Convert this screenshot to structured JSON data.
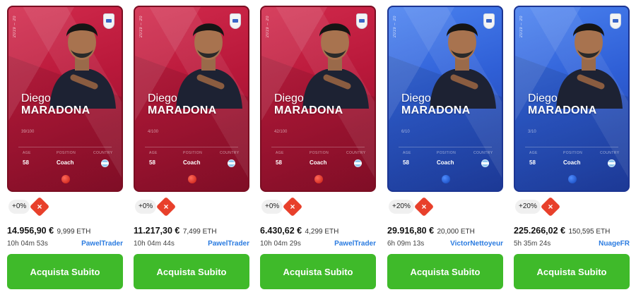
{
  "cards": [
    {
      "theme": "red",
      "season": "2019 – 20",
      "first_name": "Diego",
      "last_name": "MARADONA",
      "serial": "39/100",
      "labels": {
        "age": "AGE",
        "position": "POSITION",
        "country": "COUNTRY"
      },
      "age": "58",
      "position": "Coach",
      "change": "+0%",
      "remove_icon": "close-icon",
      "price_eur": "14.956,90 €",
      "price_eth": "9,999 ETH",
      "time_left": "10h 04m 53s",
      "seller": "PawelTrader",
      "buy_label": "Acquista Subito"
    },
    {
      "theme": "red",
      "season": "2019 – 20",
      "first_name": "Diego",
      "last_name": "MARADONA",
      "serial": "4/100",
      "labels": {
        "age": "AGE",
        "position": "POSITION",
        "country": "COUNTRY"
      },
      "age": "58",
      "position": "Coach",
      "change": "+0%",
      "remove_icon": "close-icon",
      "price_eur": "11.217,30 €",
      "price_eth": "7,499 ETH",
      "time_left": "10h 04m 44s",
      "seller": "PawelTrader",
      "buy_label": "Acquista Subito"
    },
    {
      "theme": "red",
      "season": "2019 – 20",
      "first_name": "Diego",
      "last_name": "MARADONA",
      "serial": "42/100",
      "labels": {
        "age": "AGE",
        "position": "POSITION",
        "country": "COUNTRY"
      },
      "age": "58",
      "position": "Coach",
      "change": "+0%",
      "remove_icon": "close-icon",
      "price_eur": "6.430,62 €",
      "price_eth": "4,299 ETH",
      "time_left": "10h 04m 29s",
      "seller": "PawelTrader",
      "buy_label": "Acquista Subito"
    },
    {
      "theme": "blue",
      "season": "2019 – 20",
      "first_name": "Diego",
      "last_name": "MARADONA",
      "serial": "6/10",
      "labels": {
        "age": "AGE",
        "position": "POSITION",
        "country": "COUNTRY"
      },
      "age": "58",
      "position": "Coach",
      "change": "+20%",
      "remove_icon": "close-icon",
      "price_eur": "29.916,80 €",
      "price_eth": "20,000 ETH",
      "time_left": "6h 09m 13s",
      "seller": "VictorNettoyeur",
      "buy_label": "Acquista Subito"
    },
    {
      "theme": "blue",
      "season": "2019 – 20",
      "first_name": "Diego",
      "last_name": "MARADONA",
      "serial": "3/10",
      "labels": {
        "age": "AGE",
        "position": "POSITION",
        "country": "COUNTRY"
      },
      "age": "58",
      "position": "Coach",
      "change": "+20%",
      "remove_icon": "close-icon",
      "price_eur": "225.266,02 €",
      "price_eth": "150,595 ETH",
      "time_left": "5h 35m 24s",
      "seller": "NuageFR",
      "buy_label": "Acquista Subito"
    }
  ],
  "colors": {
    "card_red": "#c21f40",
    "card_blue": "#3a6ae0",
    "buy_button": "#3fba2a",
    "seller_link": "#2a7be0",
    "remove_badge": "#e8402b"
  }
}
